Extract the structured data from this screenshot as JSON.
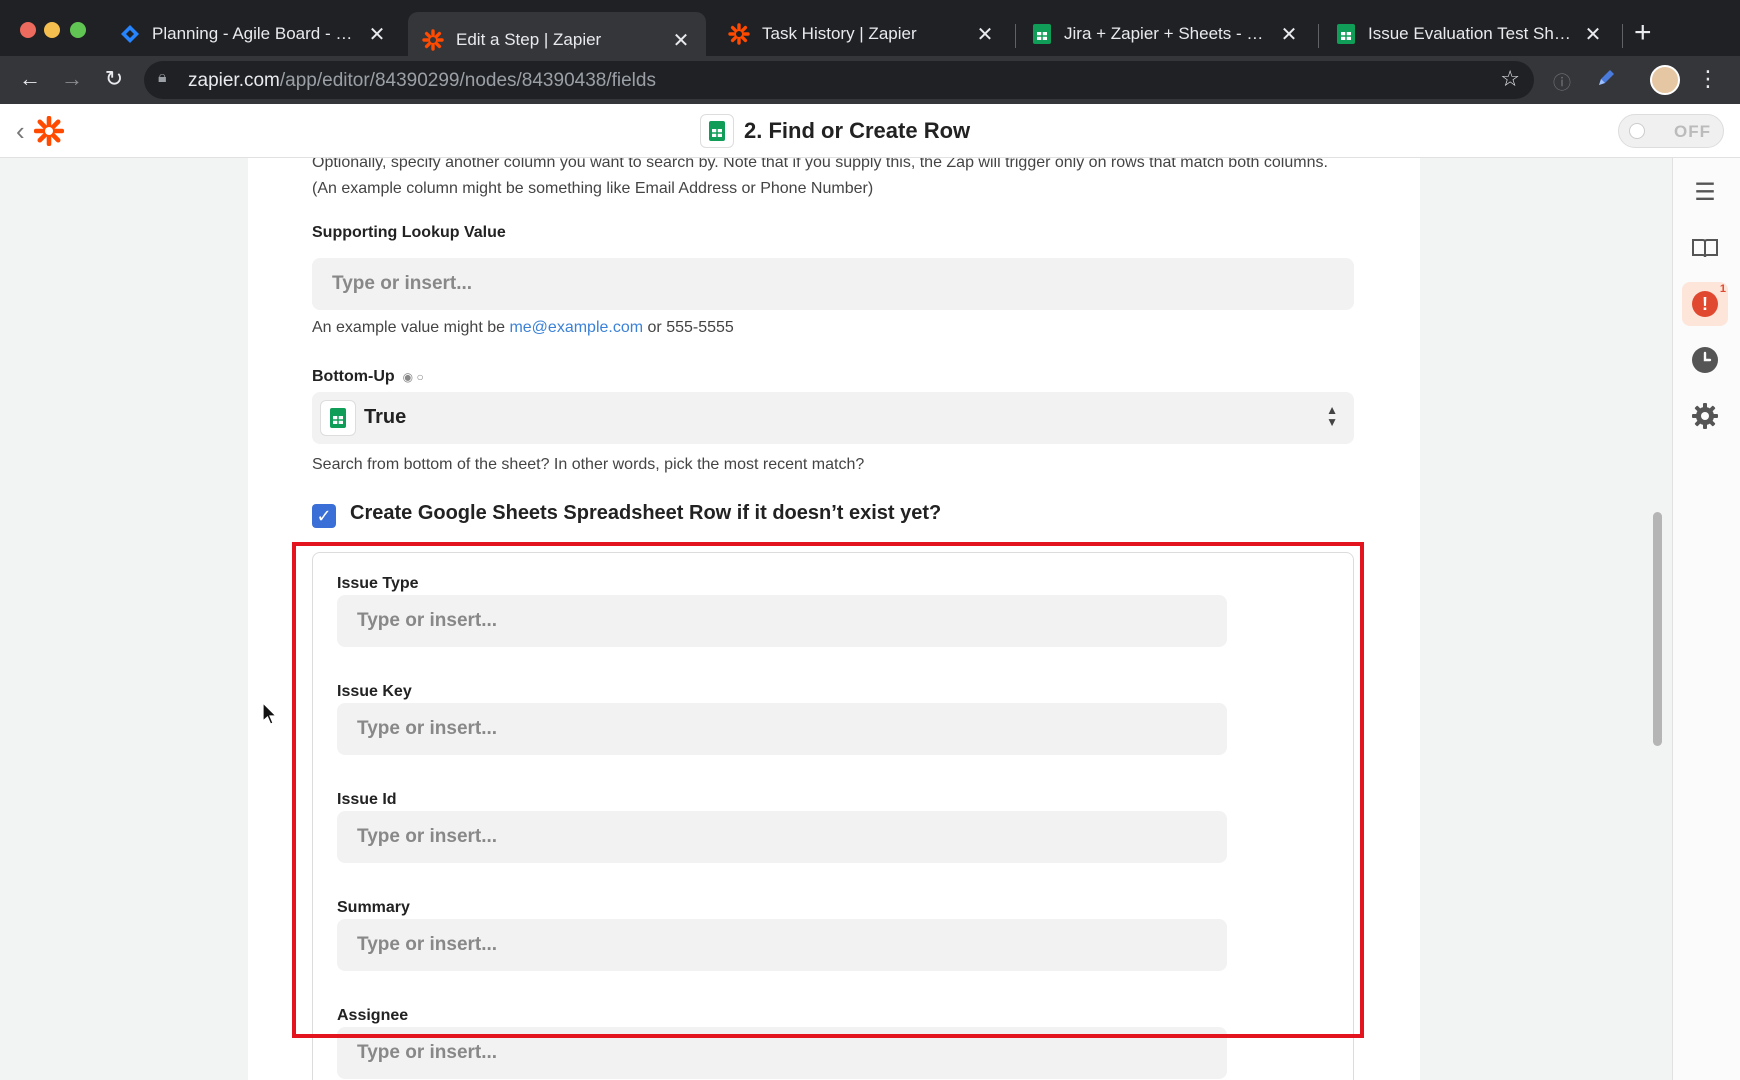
{
  "browser": {
    "tabs": [
      {
        "title": "Planning - Agile Board - JIRA",
        "icon": "jira-icon"
      },
      {
        "title": "Edit a Step | Zapier",
        "icon": "zapier-icon",
        "active": true
      },
      {
        "title": "Task History | Zapier",
        "icon": "zapier-icon"
      },
      {
        "title": "Jira + Zapier + Sheets - Google",
        "icon": "sheets-icon"
      },
      {
        "title": "Issue Evaluation Test Sheet - G",
        "icon": "sheets-icon"
      }
    ],
    "url_domain": "zapier.com",
    "url_path": "/app/editor/84390299/nodes/84390438/fields"
  },
  "header": {
    "step_title": "2. Find or Create Row",
    "toggle_label": "OFF"
  },
  "form": {
    "supporting_column_help": "Optionally, specify another column you want to search by. Note that if you supply this, the Zap will trigger only on rows that match both columns. (An example column might be something like Email Address or Phone Number)",
    "supporting_value_label": "Supporting Lookup Value",
    "placeholder": "Type or insert...",
    "example_prefix": "An example value might be ",
    "example_email": "me@example.com",
    "example_suffix": " or 555-5555",
    "bottom_up_label": "Bottom-Up",
    "bottom_up_value": "True",
    "bottom_up_help": "Search from bottom of the sheet? In other words, pick the most recent match?",
    "create_row_label": "Create Google Sheets Spreadsheet Row if it doesn’t exist yet?",
    "fields": [
      {
        "label": "Issue Type"
      },
      {
        "label": "Issue Key"
      },
      {
        "label": "Issue Id"
      },
      {
        "label": "Summary"
      },
      {
        "label": "Assignee"
      }
    ]
  },
  "sidebar": {
    "alert_count": "1"
  },
  "colors": {
    "zapier_orange": "#ff4a00",
    "highlight_red": "#e3141d",
    "checkbox_blue": "#3b6fd8",
    "sheets_green": "#0f9d58"
  }
}
